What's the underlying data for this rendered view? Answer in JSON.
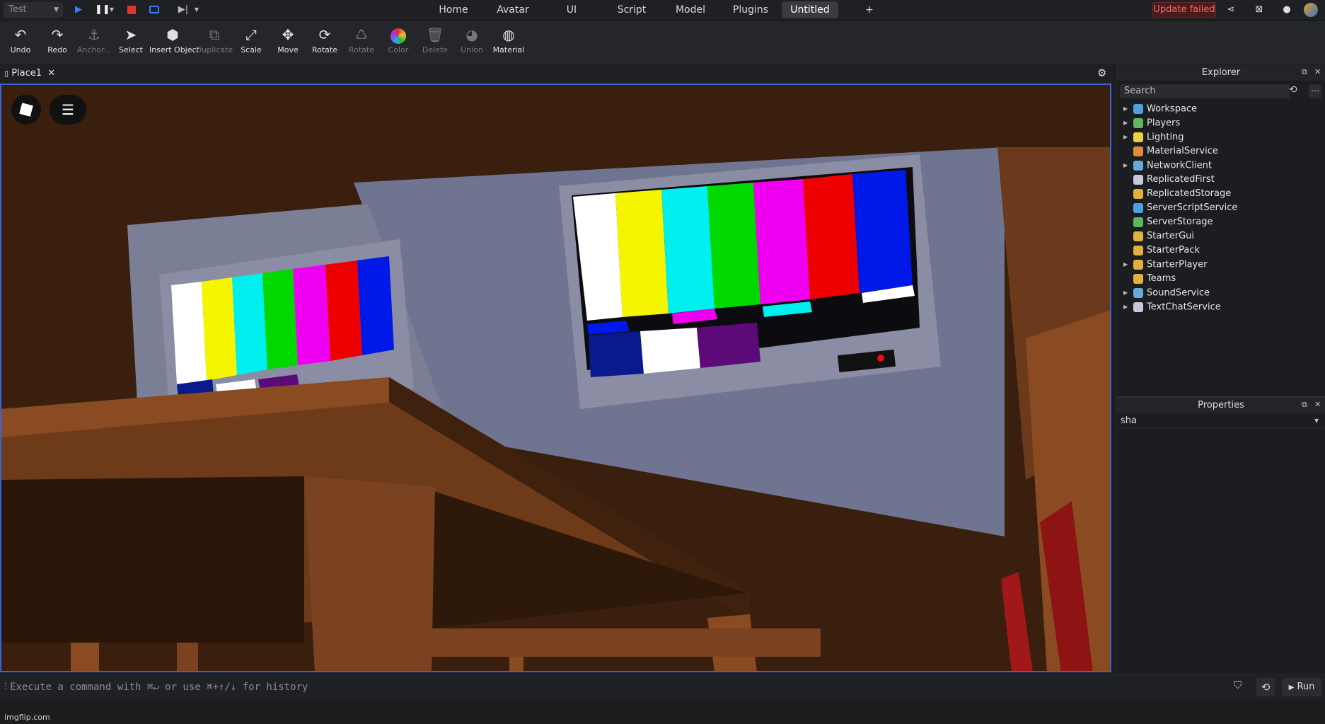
{
  "topbar": {
    "mode_select": "Test",
    "tabs": [
      "Home",
      "Avatar",
      "UI",
      "Script",
      "Model",
      "Plugins",
      "Untitled"
    ],
    "add_tab": "+",
    "update_status": "Update failed"
  },
  "ribbon": {
    "tools": [
      {
        "label": "Undo",
        "icon": "undo-icon"
      },
      {
        "label": "Redo",
        "icon": "redo-icon"
      },
      {
        "label": "Anchor...",
        "icon": "anchor-icon"
      },
      {
        "label": "Select",
        "icon": "cursor-icon"
      },
      {
        "label": "Insert Object",
        "icon": "cube-icon"
      },
      {
        "label": "Duplicate",
        "icon": "duplicate-icon"
      },
      {
        "label": "Scale",
        "icon": "scale-icon"
      },
      {
        "label": "Move",
        "icon": "move-icon"
      },
      {
        "label": "Rotate",
        "icon": "rotate-icon"
      },
      {
        "label": "Rotate",
        "icon": "rotate-alt-icon"
      },
      {
        "label": "Color",
        "icon": "color-icon"
      },
      {
        "label": "Delete",
        "icon": "trash-icon"
      },
      {
        "label": "Union",
        "icon": "union-icon"
      },
      {
        "label": "Material",
        "icon": "material-icon"
      }
    ]
  },
  "document": {
    "tab_name": "Place1"
  },
  "explorer": {
    "title": "Explorer",
    "search_placeholder": "Search",
    "items": [
      {
        "name": "Workspace",
        "expandable": true,
        "color": "#4aa3e0"
      },
      {
        "name": "Players",
        "expandable": true,
        "color": "#5fb85f"
      },
      {
        "name": "Lighting",
        "expandable": true,
        "color": "#f0d040"
      },
      {
        "name": "MaterialService",
        "expandable": false,
        "color": "#e08a3a"
      },
      {
        "name": "NetworkClient",
        "expandable": true,
        "color": "#6aa8d8"
      },
      {
        "name": "ReplicatedFirst",
        "expandable": false,
        "color": "#c8c8d8"
      },
      {
        "name": "ReplicatedStorage",
        "expandable": false,
        "color": "#e0b040"
      },
      {
        "name": "ServerScriptService",
        "expandable": false,
        "color": "#4aa3e0"
      },
      {
        "name": "ServerStorage",
        "expandable": false,
        "color": "#5fb85f"
      },
      {
        "name": "StarterGui",
        "expandable": false,
        "color": "#e0b040"
      },
      {
        "name": "StarterPack",
        "expandable": false,
        "color": "#e0b040"
      },
      {
        "name": "StarterPlayer",
        "expandable": true,
        "color": "#e0b040"
      },
      {
        "name": "Teams",
        "expandable": false,
        "color": "#e0b040"
      },
      {
        "name": "SoundService",
        "expandable": true,
        "color": "#6aa8d8"
      },
      {
        "name": "TextChatService",
        "expandable": true,
        "color": "#c8c8d8"
      }
    ]
  },
  "properties": {
    "title": "Properties",
    "filter_value": "sha"
  },
  "command_bar": {
    "placeholder": "Execute a command with ⌘↵ or use ⌘+↑/↓ for history",
    "run_label": "Run"
  },
  "watermark": "imgflip.com"
}
